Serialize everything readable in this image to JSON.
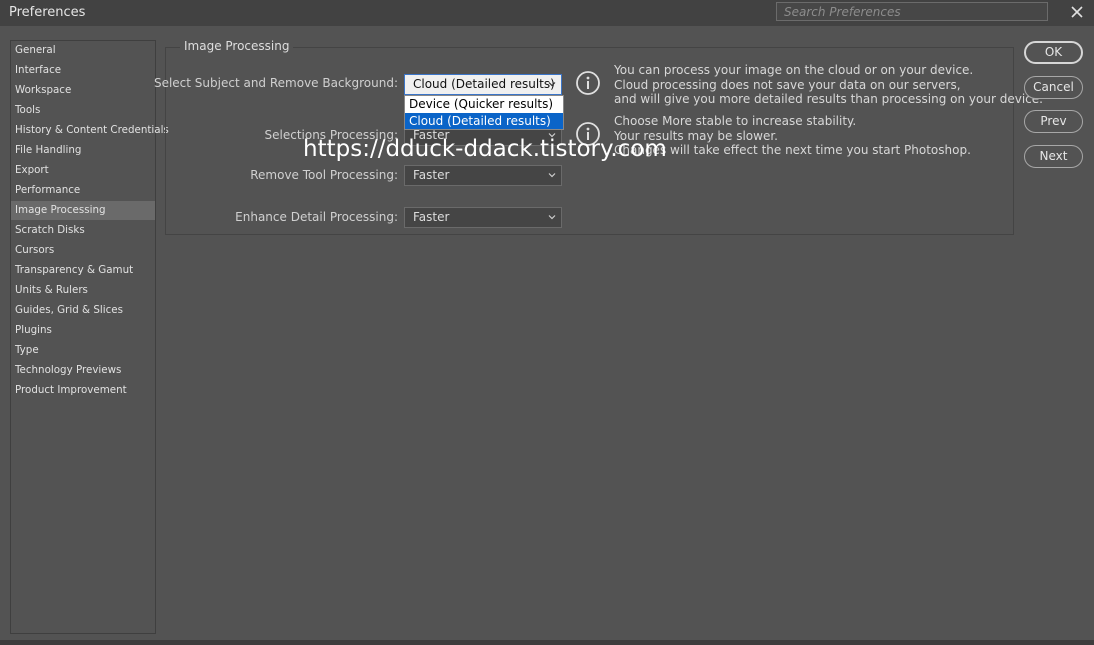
{
  "window": {
    "title": "Preferences"
  },
  "search": {
    "placeholder": "Search Preferences"
  },
  "icons": {
    "close": "close-icon",
    "info": "info-icon",
    "chevron": "chevron-down-icon"
  },
  "sidebar": {
    "items": [
      {
        "label": "General"
      },
      {
        "label": "Interface"
      },
      {
        "label": "Workspace"
      },
      {
        "label": "Tools"
      },
      {
        "label": "History & Content Credentials"
      },
      {
        "label": "File Handling"
      },
      {
        "label": "Export"
      },
      {
        "label": "Performance"
      },
      {
        "label": "Image Processing"
      },
      {
        "label": "Scratch Disks"
      },
      {
        "label": "Cursors"
      },
      {
        "label": "Transparency & Gamut"
      },
      {
        "label": "Units & Rulers"
      },
      {
        "label": "Guides, Grid & Slices"
      },
      {
        "label": "Plugins"
      },
      {
        "label": "Type"
      },
      {
        "label": "Technology Previews"
      },
      {
        "label": "Product Improvement"
      }
    ],
    "active": "Image Processing"
  },
  "panel": {
    "title": "Image Processing",
    "select_subject": {
      "label": "Select Subject and Remove Background:",
      "value": "Cloud (Detailed results)",
      "options": [
        "Device (Quicker results)",
        "Cloud (Detailed results)"
      ]
    },
    "selections": {
      "label": "Selections Processing:",
      "value": "Faster"
    },
    "remove_tool": {
      "label": "Remove Tool Processing:",
      "value": "Faster"
    },
    "enhance_detail": {
      "label": "Enhance Detail Processing:",
      "value": "Faster"
    },
    "info1": {
      "line1": "You can process your image on the cloud or on your device.",
      "line2": "Cloud processing does not save your data on our servers,",
      "line3": "and will give you more detailed results than processing on your device."
    },
    "info2": {
      "line1": "Choose More stable to increase stability.",
      "line2": "Your results may be slower.",
      "line3": "Changes will take effect the next time you start Photoshop."
    }
  },
  "watermark": "https://dduck-ddack.tistory.com",
  "buttons": {
    "ok": "OK",
    "cancel": "Cancel",
    "prev": "Prev",
    "next": "Next"
  },
  "colors": {
    "background": "#535353",
    "titlebar": "#424242",
    "selection": "#0a64c8",
    "active_item": "#6a6a6a"
  }
}
